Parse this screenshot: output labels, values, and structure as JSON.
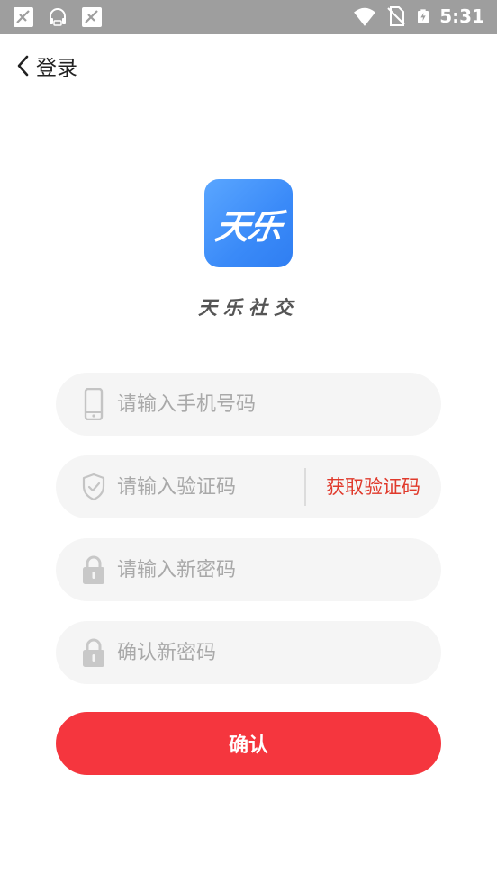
{
  "status_bar": {
    "time": "5:31",
    "icons_left": [
      "no-signal-icon",
      "headset-notification-icon",
      "no-signal-icon"
    ],
    "icons_right": [
      "wifi-icon",
      "no-sim-icon",
      "battery-charging-icon"
    ]
  },
  "header": {
    "back_icon": "chevron-left-icon",
    "title": "登录"
  },
  "app": {
    "logo_text": "天乐",
    "name": "天乐社交"
  },
  "form": {
    "phone": {
      "placeholder": "请输入手机号码",
      "value": "",
      "icon": "phone-icon"
    },
    "code": {
      "placeholder": "请输入验证码",
      "value": "",
      "icon": "shield-check-icon",
      "get_code_label": "获取验证码"
    },
    "new_password": {
      "placeholder": "请输入新密码",
      "value": "",
      "icon": "lock-icon"
    },
    "confirm_password": {
      "placeholder": "确认新密码",
      "value": "",
      "icon": "lock-icon"
    },
    "submit_label": "确认"
  },
  "colors": {
    "status_bar": "#9e9e9e",
    "field_bg": "#f5f5f5",
    "accent_red": "#f5363e",
    "link_red": "#e03a2c",
    "logo_blue": "#3a8af8"
  }
}
